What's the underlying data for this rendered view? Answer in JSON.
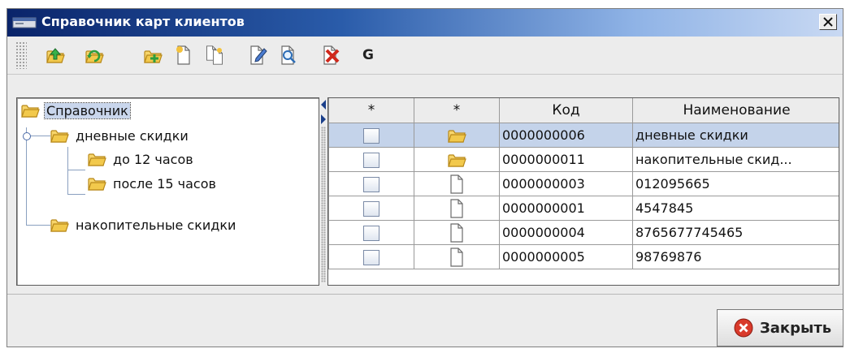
{
  "window": {
    "title": "Справочник карт клиентов"
  },
  "toolbar": {
    "buttons": [
      {
        "icon": "folder-up-icon"
      },
      {
        "icon": "folder-refresh-icon"
      },
      {
        "icon": "add-folder-icon"
      },
      {
        "icon": "new-document-icon"
      },
      {
        "icon": "copy-document-icon"
      },
      {
        "icon": "edit-document-icon"
      },
      {
        "icon": "preview-document-icon"
      },
      {
        "icon": "delete-document-icon"
      }
    ],
    "group_label": "G"
  },
  "tree": {
    "root": {
      "label": "Справочник",
      "icon": "folder-icon"
    },
    "nodes": [
      {
        "label": "дневные скидки",
        "icon": "folder-icon",
        "level": 1,
        "expanded": true
      },
      {
        "label": "до 12 часов",
        "icon": "folder-icon",
        "level": 2
      },
      {
        "label": "после 15 часов",
        "icon": "folder-icon",
        "level": 2
      },
      {
        "label": "накопительные скидки",
        "icon": "folder-icon",
        "level": 1
      }
    ]
  },
  "table": {
    "columns": [
      "*",
      "*",
      "Код",
      "Наименование"
    ],
    "rows": [
      {
        "type": "folder",
        "code": "0000000006",
        "name": "дневные скидки",
        "selected": true
      },
      {
        "type": "folder",
        "code": "0000000011",
        "name": "накопительные скид...",
        "selected": false
      },
      {
        "type": "document",
        "code": "0000000003",
        "name": "012095665",
        "selected": false
      },
      {
        "type": "document",
        "code": "0000000001",
        "name": "4547845",
        "selected": false
      },
      {
        "type": "document",
        "code": "0000000004",
        "name": "8765677745465",
        "selected": false
      },
      {
        "type": "document",
        "code": "0000000005",
        "name": "98769876",
        "selected": false
      }
    ]
  },
  "footer": {
    "close_label": "Закрыть"
  },
  "colors": {
    "title_gradient_start": "#0a246a",
    "selection": "#c4d3ea",
    "folder": "#f2c94c",
    "close_red": "#d93a2b"
  }
}
